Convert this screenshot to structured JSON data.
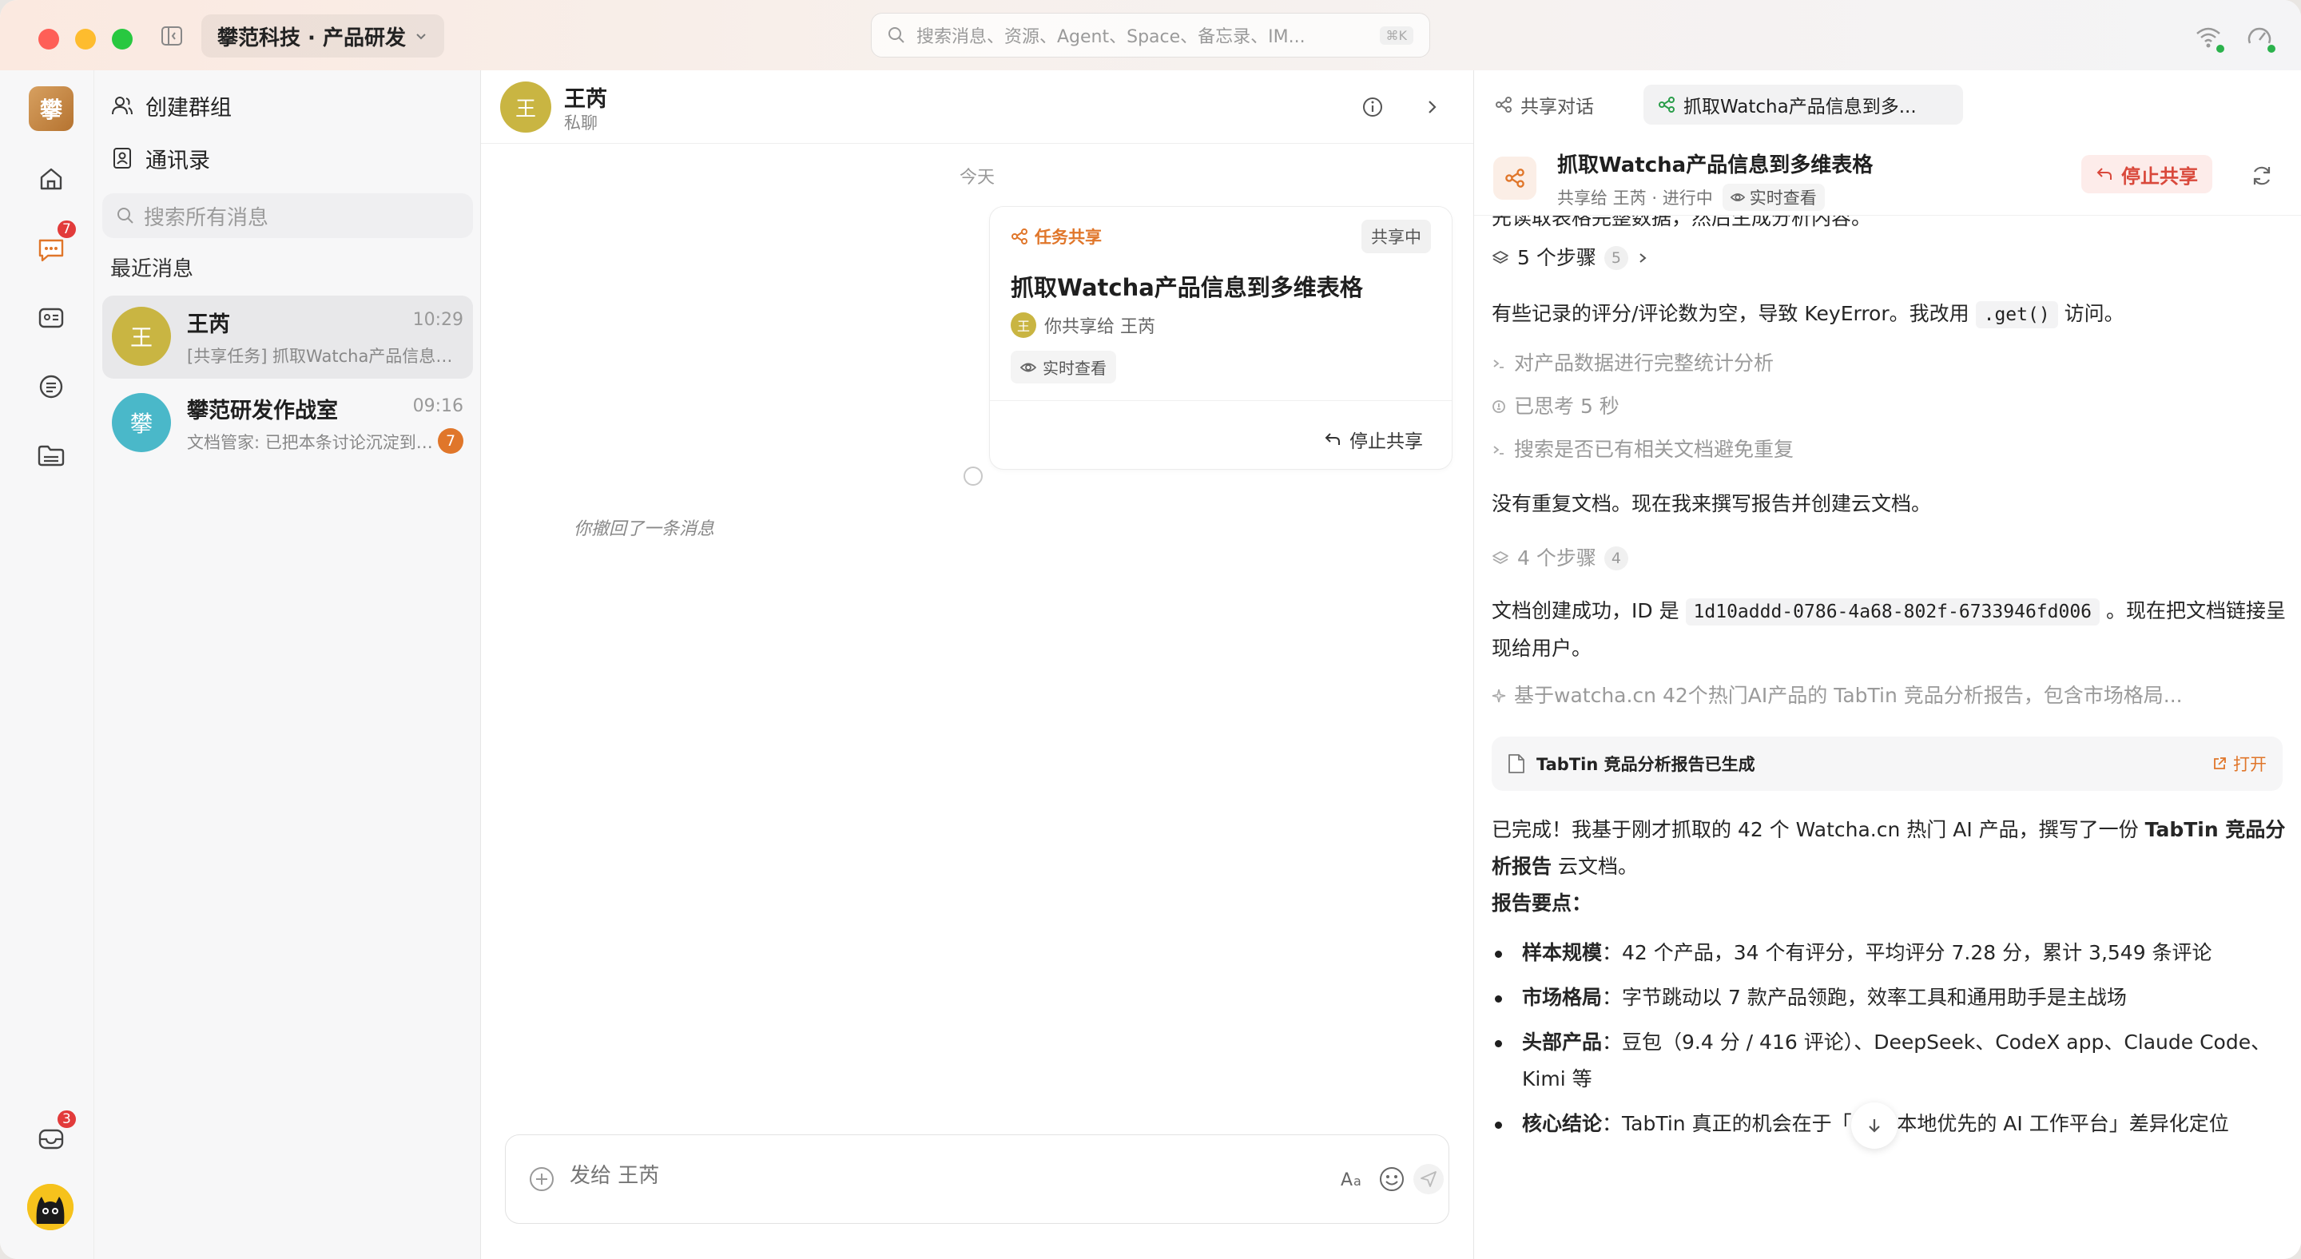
{
  "titlebar": {
    "workspace": "攀范科技 · 产品研发",
    "search_placeholder": "搜索消息、资源、Agent、Space、备忘录、IM...",
    "search_shortcut": "⌘K"
  },
  "rail": {
    "logo_text": "攀",
    "messages_badge": "7",
    "mail_badge": "3"
  },
  "chatlist": {
    "create_group": "创建群组",
    "contacts": "通讯录",
    "search_placeholder": "搜索所有消息",
    "section_recent": "最近消息",
    "items": [
      {
        "avatar": "王",
        "avatar_color": "#c9b542",
        "name": "王芮",
        "time": "10:29",
        "preview": "[共享任务] 抓取Watcha产品信息到多维表格",
        "unread": ""
      },
      {
        "avatar": "攀",
        "avatar_color": "#4ab8c9",
        "name": "攀范研发作战室",
        "time": "09:16",
        "preview": "文档管家: 已把本条讨论沉淀到云文档",
        "unread": "7"
      }
    ]
  },
  "conversation": {
    "avatar": "王",
    "name": "王芮",
    "subtitle": "私聊",
    "date_divider": "今天",
    "card": {
      "tag": "任务共享",
      "state": "共享中",
      "title": "抓取Watcha产品信息到多维表格",
      "share_avatar": "王",
      "share_text": "你共享给 王芮",
      "live_label": "实时查看",
      "stop_label": "停止共享"
    },
    "recalled_text": "你撤回了一条消息",
    "composer_placeholder": "发给 王芮"
  },
  "panel": {
    "tab_shared": "共享对话",
    "tab_task": "抓取Watcha产品信息到多...",
    "title": "抓取Watcha产品信息到多维表格",
    "subtitle": "共享给 王芮 · 进行中",
    "live_label": "实时查看",
    "stop_label": "停止共享",
    "top_cut_text": "先读取表格完整数据，然后生成分析内容。",
    "steps1_label": "5 个步骤",
    "steps1_count": "5",
    "error_text_a": "有些记录的评分/评论数为空，导致 KeyError。我改用",
    "error_code": ".get()",
    "error_text_b": "访问。",
    "tool1": "对产品数据进行完整统计分析",
    "thought": "已思考 5 秒",
    "tool2": "搜索是否已有相关文档避免重复",
    "no_dup": "没有重复文档。现在我来撰写报告并创建云文档。",
    "steps2_label": "4 个步骤",
    "steps2_count": "4",
    "doc_created_a": "文档创建成功，ID 是",
    "doc_id": "1d10addd-0786-4a68-802f-6733946fd006",
    "doc_created_b": "。现在把文档链接呈现给用户。",
    "gen_summary": "基于watcha.cn 42个热门AI产品的 TabTin 竞品分析报告，包含市场格局...",
    "doc_card_title": "TabTin 竞品分析报告已生成",
    "doc_card_open": "打开",
    "done_a": "已完成！我基于刚才抓取的 42 个 Watcha.cn 热门 AI 产品，撰写了一份",
    "done_bold": "TabTin 竞品分析报告",
    "done_b": "云文档。",
    "points_title": "报告要点：",
    "bullets": [
      {
        "label": "样本规模",
        "text": "：42 个产品，34 个有评分，平均评分 7.28 分，累计 3,549 条评论"
      },
      {
        "label": "市场格局",
        "text": "：字节跳动以 7 款产品领跑，效率工具和通用助手是主战场"
      },
      {
        "label": "头部产品",
        "text": "：豆包（9.4 分 / 416 评论）、DeepSeek、CodeX app、Claude Code、Kimi 等"
      },
      {
        "label": "核心结论",
        "text": "：TabTin 真正的机会在于「App 本地优先的 AI 工作平台」差异化定位"
      }
    ]
  },
  "colors": {
    "accent_orange": "#e0762a",
    "stop_red": "#d9483b",
    "badge_red": "#e23b3b"
  }
}
